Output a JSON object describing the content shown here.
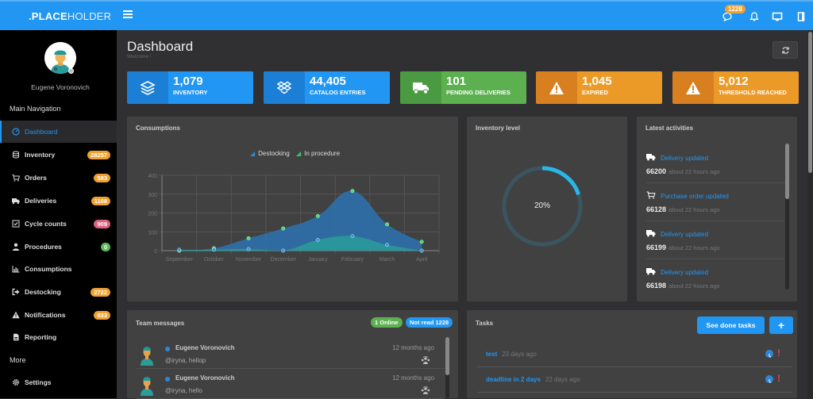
{
  "app": {
    "brand_bold": ".PLACE",
    "brand_light": "HOLDER",
    "header": {
      "messages_badge": "1228",
      "icons": [
        "comment-icon",
        "bell-icon",
        "monitor-icon",
        "panel-toggle-icon"
      ]
    }
  },
  "sidebar": {
    "user_name": "Eugene Voronovich",
    "main_heading": "Main Navigation",
    "more_heading": "More",
    "items": [
      {
        "label": "Dashboard",
        "icon": "dashboard-icon",
        "active": true,
        "badge": null
      },
      {
        "label": "Inventory",
        "icon": "database-icon",
        "badge": "28257",
        "badge_color": "#f0a030"
      },
      {
        "label": "Orders",
        "icon": "cart-icon",
        "badge": "583",
        "badge_color": "#f0a030"
      },
      {
        "label": "Deliveries",
        "icon": "truck-icon",
        "badge": "1108",
        "badge_color": "#f0a030"
      },
      {
        "label": "Cycle counts",
        "icon": "checkbox-icon",
        "badge": "909",
        "badge_color": "#e0607e"
      },
      {
        "label": "Procedures",
        "icon": "user-tie-icon",
        "badge": "0",
        "badge_color": "#5cb85c"
      },
      {
        "label": "Consumptions",
        "icon": "bar-chart-icon",
        "badge": null
      },
      {
        "label": "Destocking",
        "icon": "sign-out-icon",
        "badge": "2722",
        "badge_color": "#f0a030"
      },
      {
        "label": "Notifications",
        "icon": "warning-icon",
        "badge": "833",
        "badge_color": "#f0a030"
      },
      {
        "label": "Reporting",
        "icon": "file-icon",
        "badge": null
      }
    ],
    "more_items": [
      {
        "label": "Settings",
        "icon": "gear-icon"
      }
    ]
  },
  "page": {
    "title": "Dashboard",
    "subtitle": "Welcome !"
  },
  "stats": [
    {
      "value": "1,079",
      "label": "Inventory",
      "icon": "layers-icon",
      "color": "#2196f3",
      "dark": "#1c7fd6"
    },
    {
      "value": "44,405",
      "label": "Catalog entries",
      "icon": "dropbox-icon",
      "color": "#2196f3",
      "dark": "#1c7fd6"
    },
    {
      "value": "101",
      "label": "Pending deliveries",
      "icon": "truck-icon",
      "color": "#5cb050",
      "dark": "#4a9a42"
    },
    {
      "value": "1,045",
      "label": "Expired",
      "icon": "warning-icon",
      "color": "#ec9a27",
      "dark": "#d8801f"
    },
    {
      "value": "5,012",
      "label": "Threshold reached",
      "icon": "warning-icon",
      "color": "#ec9a27",
      "dark": "#d8801f"
    }
  ],
  "consumptions": {
    "title": "Consumptions"
  },
  "chart_data": {
    "type": "area",
    "title": "Consumptions",
    "categories": [
      "September",
      "October",
      "November",
      "December",
      "January",
      "February",
      "March",
      "April"
    ],
    "series": [
      {
        "name": "Destocking",
        "values": [
          5,
          5,
          8,
          0,
          57,
          77,
          31,
          0
        ],
        "legend_color": "#2f86d6",
        "fill": "#2a9a9a",
        "point": "#3b8fe8"
      },
      {
        "name": "In procedure",
        "values": [
          0,
          13,
          66,
          118,
          184,
          317,
          140,
          47
        ],
        "legend_color": "#35c46a",
        "fill": "#2e6fa8",
        "point": "#4ddb6c"
      }
    ],
    "xlabel": "",
    "ylabel": "",
    "ylim": [
      0,
      400
    ],
    "yticks": [
      0,
      100,
      200,
      300,
      400
    ],
    "grid": true,
    "legend": "top-center"
  },
  "inventory_level": {
    "title": "Inventory level",
    "percent": 20,
    "label": "20%"
  },
  "activities": {
    "title": "Latest activities",
    "items": [
      {
        "icon": "truck-icon",
        "title": "Delivery updated",
        "id": "66200",
        "time": "about 22 hours ago"
      },
      {
        "icon": "cart-icon",
        "title": "Purchase order updated",
        "id": "66128",
        "time": "about 22 hours ago"
      },
      {
        "icon": "truck-icon",
        "title": "Delivery updated",
        "id": "66199",
        "time": "about 22 hours ago"
      },
      {
        "icon": "truck-icon",
        "title": "Delivery updated",
        "id": "66198",
        "time": "about 22 hours ago"
      }
    ]
  },
  "team_messages": {
    "title": "Team messages",
    "online_label": "1 Online",
    "unread_label": "Not read 1228",
    "messages": [
      {
        "author": "Eugene Voronovich",
        "text": "@iryna, hellop",
        "time": "12 months ago"
      },
      {
        "author": "Eugene Voronovich",
        "text": "@iryna, hello",
        "time": "12 months ago"
      }
    ]
  },
  "tasks": {
    "title": "Tasks",
    "see_done_label": "See done tasks",
    "add_label": "+",
    "items": [
      {
        "name": "test",
        "age": "23 days ago"
      },
      {
        "name": "deadline in 2 days",
        "age": "22 days ago"
      }
    ]
  }
}
